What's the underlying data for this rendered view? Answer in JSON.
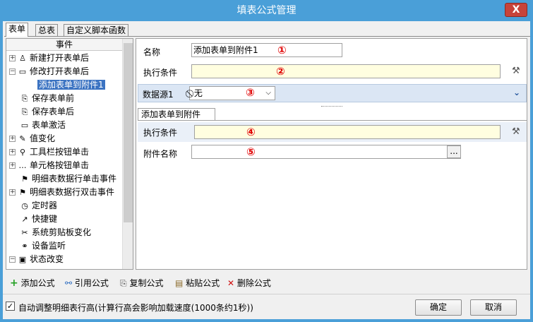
{
  "window": {
    "title": "填表公式管理",
    "close_label": "X"
  },
  "tabs": [
    {
      "label": "表单"
    },
    {
      "label": "总表"
    },
    {
      "label": "自定义脚本函数"
    }
  ],
  "tree": {
    "header": "事件",
    "items": [
      {
        "label": "新建打开表单后",
        "icon": "user-icon",
        "glyph": "♙",
        "expander": "+"
      },
      {
        "label": "修改打开表单后",
        "icon": "folder-icon",
        "glyph": "▭",
        "expander": "−"
      },
      {
        "label": "添加表单到附件1",
        "icon": "",
        "glyph": "",
        "expander": "",
        "selected": true
      },
      {
        "label": "保存表单前",
        "icon": "save-icon",
        "glyph": "⎘",
        "expander": ""
      },
      {
        "label": "保存表单后",
        "icon": "save-icon",
        "glyph": "⎘",
        "expander": ""
      },
      {
        "label": "表单激活",
        "icon": "folder-icon",
        "glyph": "▭",
        "expander": ""
      },
      {
        "label": "值变化",
        "icon": "value-change-icon",
        "glyph": "✎",
        "expander": "+"
      },
      {
        "label": "工具栏按钮单击",
        "icon": "search-icon",
        "glyph": "⚲",
        "expander": "+"
      },
      {
        "label": "单元格按钮单击",
        "icon": "ellipsis-icon",
        "glyph": "…",
        "expander": "+"
      },
      {
        "label": "明细表数据行单击事件",
        "icon": "flag-icon",
        "glyph": "⚑",
        "expander": ""
      },
      {
        "label": "明细表数据行双击事件",
        "icon": "flag-icon",
        "glyph": "⚑",
        "expander": "+"
      },
      {
        "label": "定时器",
        "icon": "timer-icon",
        "glyph": "◷",
        "expander": ""
      },
      {
        "label": "快捷键",
        "icon": "shortcut-icon",
        "glyph": "↗",
        "expander": ""
      },
      {
        "label": "系统剪贴板变化",
        "icon": "scissors-icon",
        "glyph": "✂",
        "expander": ""
      },
      {
        "label": "设备监听",
        "icon": "device-icon",
        "glyph": "⚭",
        "expander": ""
      },
      {
        "label": "状态改变",
        "icon": "status-icon",
        "glyph": "▣",
        "expander": "−"
      },
      {
        "label": "...",
        "icon": "",
        "glyph": "",
        "expander": ""
      }
    ]
  },
  "form": {
    "name_label": "名称",
    "name_value": "添加表单到附件1",
    "condition_label": "执行条件",
    "condition_value": "",
    "datasource_label": "数据源1",
    "datasource_value": "无",
    "section_title": "添加表单到附件",
    "condition2_label": "执行条件",
    "condition2_value": "",
    "attach_label": "附件名称",
    "attach_value": "",
    "browse_label": "...",
    "markers": [
      "①",
      "②",
      "③",
      "④",
      "⑤"
    ]
  },
  "toolbar": {
    "add": "添加公式",
    "ref": "引用公式",
    "copy": "复制公式",
    "paste": "粘贴公式",
    "delete": "删除公式"
  },
  "footer": {
    "auto_adjust_label": "自动调整明细表行高(计算行高会影响加载速度(1000条约1秒))",
    "auto_adjust_checked": true,
    "ok": "确定",
    "cancel": "取消"
  },
  "colors": {
    "titlebar": "#4a9fd8",
    "close": "#c7433a",
    "marker": "#e00000",
    "selected": "#3b73c2",
    "condition_bg": "#fffee0"
  }
}
